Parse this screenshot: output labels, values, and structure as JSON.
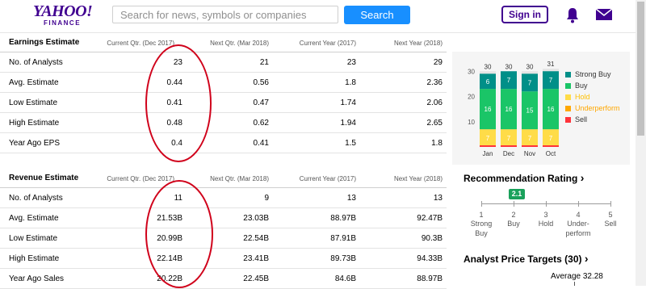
{
  "header": {
    "logo_line1": "YAHOO!",
    "logo_line2": "FINANCE",
    "search_placeholder": "Search for news, symbols or companies",
    "search_button": "Search",
    "signin": "Sign in"
  },
  "earnings": {
    "title": "Earnings Estimate",
    "columns": [
      "Current Qtr. (Dec 2017)",
      "Next Qtr. (Mar 2018)",
      "Current Year (2017)",
      "Next Year (2018)"
    ],
    "rows": [
      {
        "label": "No. of Analysts",
        "values": [
          "23",
          "21",
          "23",
          "29"
        ]
      },
      {
        "label": "Avg. Estimate",
        "values": [
          "0.44",
          "0.56",
          "1.8",
          "2.36"
        ]
      },
      {
        "label": "Low Estimate",
        "values": [
          "0.41",
          "0.47",
          "1.74",
          "2.06"
        ]
      },
      {
        "label": "High Estimate",
        "values": [
          "0.48",
          "0.62",
          "1.94",
          "2.65"
        ]
      },
      {
        "label": "Year Ago EPS",
        "values": [
          "0.4",
          "0.41",
          "1.5",
          "1.8"
        ]
      }
    ]
  },
  "revenue": {
    "title": "Revenue Estimate",
    "columns": [
      "Current Qtr. (Dec 2017)",
      "Next Qtr. (Mar 2018)",
      "Current Year (2017)",
      "Next Year (2018)"
    ],
    "rows": [
      {
        "label": "No. of Analysts",
        "values": [
          "11",
          "9",
          "13",
          "13"
        ]
      },
      {
        "label": "Avg. Estimate",
        "values": [
          "21.53B",
          "23.03B",
          "88.97B",
          "92.47B"
        ]
      },
      {
        "label": "Low Estimate",
        "values": [
          "20.99B",
          "22.54B",
          "87.91B",
          "90.3B"
        ]
      },
      {
        "label": "High Estimate",
        "values": [
          "22.14B",
          "23.41B",
          "89.73B",
          "94.33B"
        ]
      },
      {
        "label": "Year Ago Sales",
        "values": [
          "20.22B",
          "22.45B",
          "84.6B",
          "88.97B"
        ]
      }
    ]
  },
  "chart_data": {
    "type": "bar",
    "stacked": true,
    "categories": [
      "Jan",
      "Dec",
      "Nov",
      "Oct"
    ],
    "totals": [
      30,
      30,
      30,
      31
    ],
    "yticks": [
      10,
      20,
      30
    ],
    "ylim": [
      0,
      32
    ],
    "series": [
      {
        "name": "Sell",
        "color": "#ff333a",
        "values": [
          0,
          0,
          0,
          0
        ]
      },
      {
        "name": "Underperform",
        "color": "#ffa700",
        "values": [
          0,
          0,
          0,
          0
        ]
      },
      {
        "name": "Hold",
        "color": "#ffdc48",
        "values": [
          7,
          7,
          7,
          7
        ]
      },
      {
        "name": "Buy",
        "color": "#1ac567",
        "values": [
          16,
          16,
          15,
          16
        ]
      },
      {
        "name": "Strong Buy",
        "color": "#008f88",
        "values": [
          6,
          7,
          7,
          7
        ]
      }
    ],
    "legend": [
      "Strong Buy",
      "Buy",
      "Hold",
      "Underperform",
      "Sell"
    ],
    "legend_colors": [
      "#008f88",
      "#1ac567",
      "#ffdc48",
      "#ffa700",
      "#ff333a"
    ],
    "legend_placement": "right"
  },
  "recommendation": {
    "title": "Recommendation Rating",
    "chevron": "›",
    "value": "2.1",
    "value_number": 2.1,
    "scale": [
      {
        "num": "1",
        "label": "Strong Buy"
      },
      {
        "num": "2",
        "label": "Buy"
      },
      {
        "num": "3",
        "label": "Hold"
      },
      {
        "num": "4",
        "label": "Under-perform"
      },
      {
        "num": "5",
        "label": "Sell"
      }
    ]
  },
  "targets": {
    "title": "Analyst Price Targets (30)",
    "chevron": "›",
    "average_label": "Average 32.28"
  }
}
